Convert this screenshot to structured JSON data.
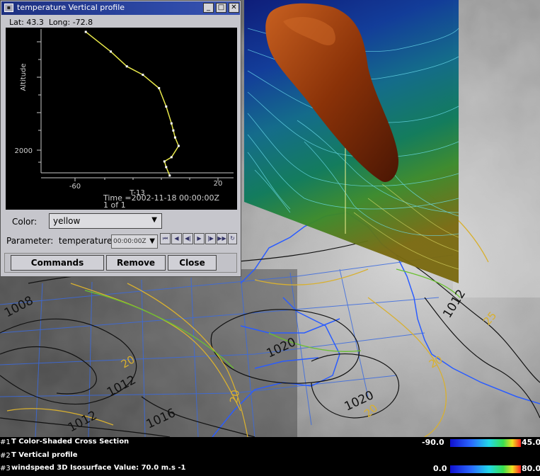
{
  "window": {
    "title": "temperature Vertical profile",
    "min_symbol": "_",
    "max_symbol": "□",
    "close_symbol": "✕"
  },
  "location": {
    "lat_label": "Lat: 43.3",
    "long_label": "Long: -72.8"
  },
  "chart_data": {
    "type": "line",
    "title": "",
    "xlabel": "T-13",
    "ylabel": "Altitude",
    "x_ticks": [
      "-60",
      "20"
    ],
    "y_ticks": [
      "2000"
    ],
    "series": [
      {
        "x": [
          -54,
          -40,
          -31,
          -22,
          -13,
          -9,
          -6,
          -5,
          -4,
          -2,
          -6,
          -10,
          -9,
          -7
        ],
        "y": [
          10400,
          9000,
          7950,
          7350,
          6400,
          5100,
          3900,
          3400,
          2900,
          2300,
          1500,
          1200,
          800,
          200
        ]
      }
    ],
    "line_color": "#e8e84a",
    "point_color": "#ffffff"
  },
  "time_readout": {
    "line1": "Time =2002-11-18 00:00:00Z",
    "line2": "1 of 1"
  },
  "color_control": {
    "label": "Color:",
    "value": "yellow"
  },
  "parameter_control": {
    "label": "Parameter:",
    "value": "temperature",
    "time_value": "00:00:00Z"
  },
  "animation_buttons": [
    "⏮",
    "◀",
    "◀|",
    "▶",
    "|▶",
    "▶▶",
    "↻"
  ],
  "buttons": {
    "commands": "Commands",
    "remove": "Remove",
    "close": "Close"
  },
  "contour_labels": [
    "1008",
    "1012",
    "1020",
    "1012",
    "1020",
    "1016",
    "20",
    "20",
    "20",
    "20",
    "25",
    "1012"
  ],
  "legend": [
    {
      "number": "#1",
      "text": "T Color-Shaded Cross Section",
      "min": "-90.0",
      "max": "45.0"
    },
    {
      "number": "#2",
      "text": "T Vertical profile"
    },
    {
      "number": "#3",
      "text": "windspeed 3D Isosurface Value: 70.0 m.s -1",
      "min": "0.0",
      "max": "80.0"
    }
  ]
}
